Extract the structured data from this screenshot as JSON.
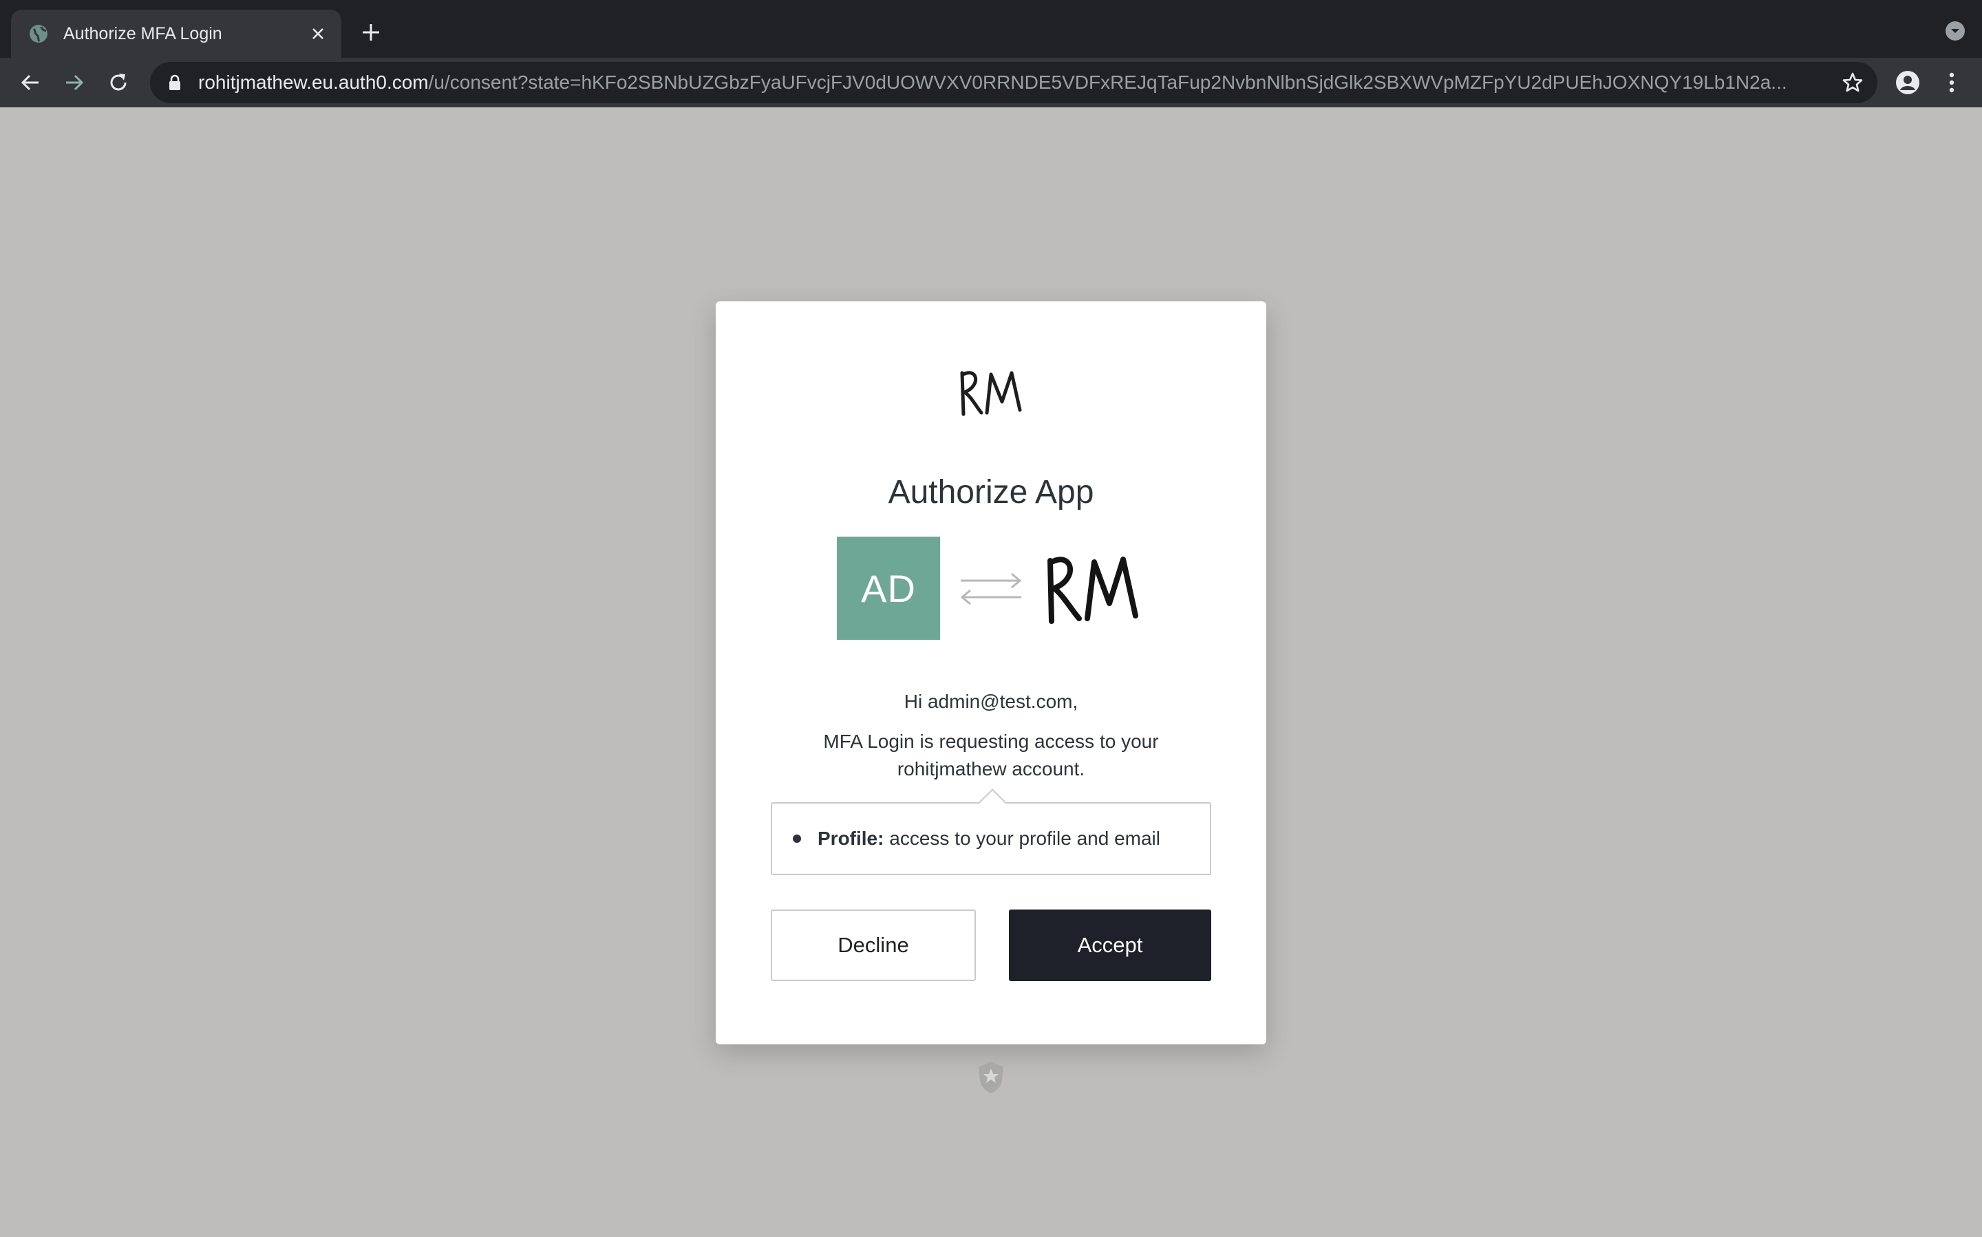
{
  "browser": {
    "tab_title": "Authorize MFA Login",
    "url_host": "rohitjmathew.eu.auth0.com",
    "url_path": "/u/consent?state=hKFo2SBNbUZGbzFyaUFvcjFJV0dUOWVXV0RRNDE5VDFxREJqTaFup2NvbnNlbnSjdGlk2SBXWVpMZFpYU2dPUEhJOXNQY19Lb1N2a..."
  },
  "consent": {
    "logo_text": "RM",
    "title": "Authorize App",
    "app_initials": "AD",
    "greeting": "Hi admin@test.com,",
    "description": "MFA Login is requesting access to your rohitjmathew account.",
    "scopes": [
      {
        "name": "Profile:",
        "description": "access to your profile and email"
      }
    ],
    "decline_label": "Decline",
    "accept_label": "Accept"
  },
  "colors": {
    "app_avatar": "#6fa796",
    "accept_button": "#1e212a",
    "page_background": "#bebdbb"
  }
}
